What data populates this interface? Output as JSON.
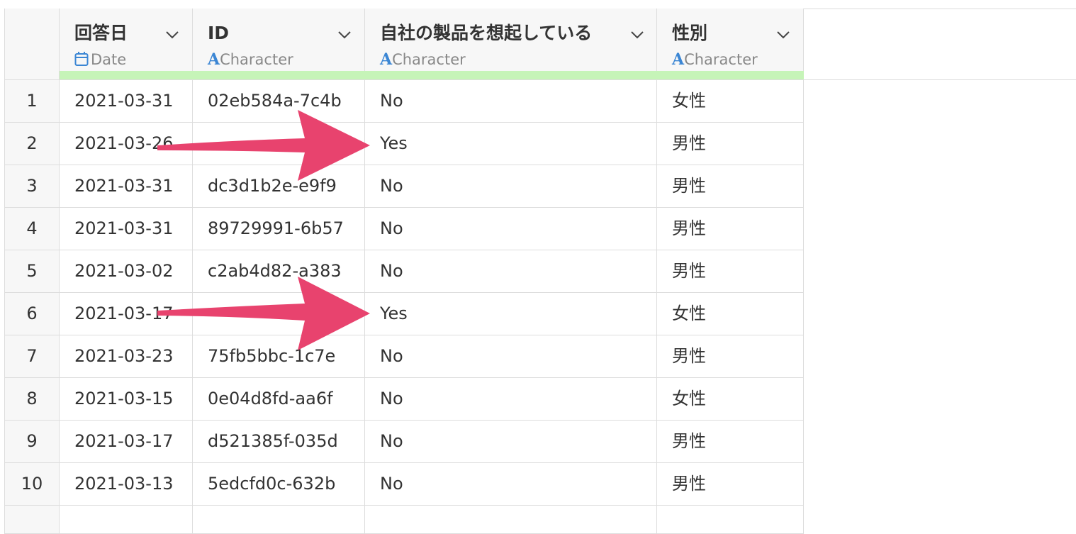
{
  "columns": [
    {
      "name": "回答日",
      "type": "Date",
      "type_icon": "calendar-icon"
    },
    {
      "name": "ID",
      "type": "Character",
      "type_icon": "letter-a-icon"
    },
    {
      "name": "自社の製品を想起している",
      "type": "Character",
      "type_icon": "letter-a-icon"
    },
    {
      "name": "性別",
      "type": "Character",
      "type_icon": "letter-a-icon"
    }
  ],
  "rows": [
    {
      "n": "1",
      "date": "2021-03-31",
      "id": "02eb584a-7c4b",
      "recall": "No",
      "gender": "女性"
    },
    {
      "n": "2",
      "date": "2021-03-26",
      "id": "",
      "recall": "Yes",
      "gender": "男性"
    },
    {
      "n": "3",
      "date": "2021-03-31",
      "id": "dc3d1b2e-e9f9",
      "recall": "No",
      "gender": "男性"
    },
    {
      "n": "4",
      "date": "2021-03-31",
      "id": "89729991-6b57",
      "recall": "No",
      "gender": "男性"
    },
    {
      "n": "5",
      "date": "2021-03-02",
      "id": "c2ab4d82-a383",
      "recall": "No",
      "gender": "男性"
    },
    {
      "n": "6",
      "date": "2021-03-17",
      "id": "",
      "recall": "Yes",
      "gender": "女性"
    },
    {
      "n": "7",
      "date": "2021-03-23",
      "id": "75fb5bbc-1c7e",
      "recall": "No",
      "gender": "男性"
    },
    {
      "n": "8",
      "date": "2021-03-15",
      "id": "0e04d8fd-aa6f",
      "recall": "No",
      "gender": "女性"
    },
    {
      "n": "9",
      "date": "2021-03-17",
      "id": "d521385f-035d",
      "recall": "No",
      "gender": "男性"
    },
    {
      "n": "10",
      "date": "2021-03-13",
      "id": "5edcfd0c-632b",
      "recall": "No",
      "gender": "男性"
    }
  ],
  "colors": {
    "arrow": "#e8436e",
    "quality_bar": "#c6f4b8",
    "type_icon": "#3b86d4"
  }
}
